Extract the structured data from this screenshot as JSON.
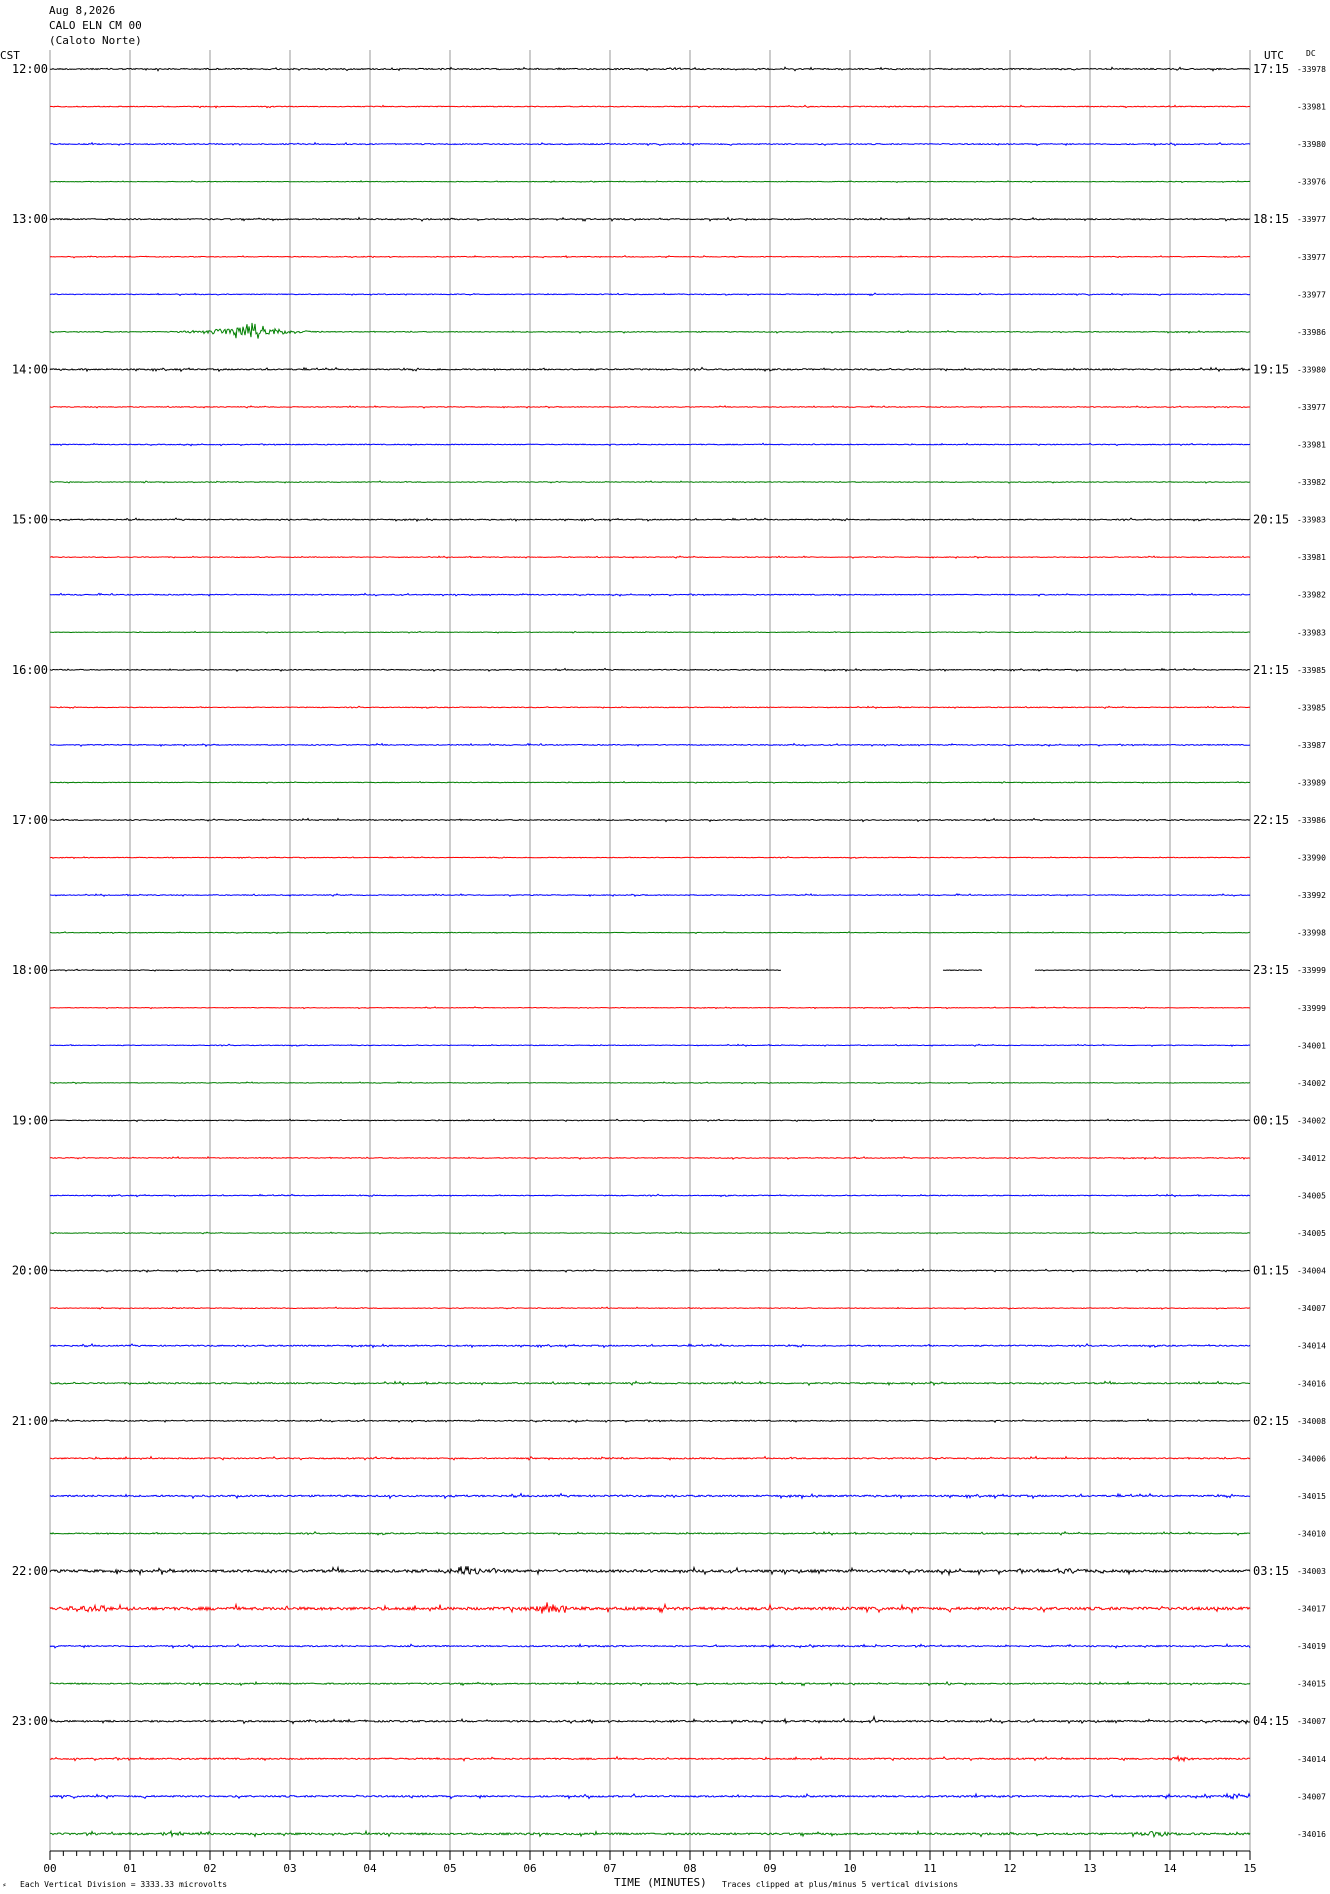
{
  "header": {
    "date": "Aug 8,2026",
    "station": "CALO ELN CM 00",
    "location": "(Caloto Norte)"
  },
  "left_axis_label": "CST",
  "right_axis_label": "UTC",
  "dc_label": "DC",
  "footer": {
    "mark": "⸗",
    "scale_note": "Each Vertical Division = 3333.33 microvolts",
    "xlabel": "TIME (MINUTES)",
    "clip_note": "Traces clipped at plus/minus 5 vertical divisions"
  },
  "colors": {
    "trace_cycle": [
      "#000000",
      "#ff0000",
      "#0000ff",
      "#007f00"
    ],
    "grid": "#999999"
  },
  "chart_data": {
    "type": "line",
    "title": "",
    "xlabel": "TIME (MINUTES)",
    "xlim": [
      0,
      15
    ],
    "x_ticks": [
      "00",
      "01",
      "02",
      "03",
      "04",
      "05",
      "06",
      "07",
      "08",
      "09",
      "10",
      "11",
      "12",
      "13",
      "14",
      "15"
    ],
    "rows_per_hour": 4,
    "hour_labels_cst": [
      "12:00",
      "13:00",
      "14:00",
      "15:00",
      "16:00",
      "17:00",
      "18:00",
      "19:00",
      "20:00",
      "21:00",
      "22:00",
      "23:00"
    ],
    "hour_labels_utc": [
      "17:15",
      "18:15",
      "19:15",
      "20:15",
      "21:15",
      "22:15",
      "23:15",
      "00:15",
      "01:15",
      "02:15",
      "03:15",
      "04:15"
    ],
    "dc_offsets": [
      "-33978",
      "-33981",
      "-33980",
      "-33976",
      "-33977",
      "-33977",
      "-33977",
      "-33986",
      "-33980",
      "-33977",
      "-33981",
      "-33982",
      "-33983",
      "-33981",
      "-33982",
      "-33983",
      "-33985",
      "-33985",
      "-33987",
      "-33989",
      "-33986",
      "-33990",
      "-33992",
      "-33998",
      "-33999",
      "-33999",
      "-34001",
      "-34002",
      "-34002",
      "-34012",
      "-34005",
      "-34005",
      "-34004",
      "-34007",
      "-34014",
      "-34016",
      "-34008",
      "-34006",
      "-34015",
      "-34010",
      "-34003",
      "-34017",
      "-34019",
      "-34015",
      "-34007",
      "-34014",
      "-34007",
      "-34016"
    ],
    "noise_level": [
      1.2,
      0.8,
      1,
      0.6,
      1.2,
      0.7,
      0.8,
      0.8,
      1.3,
      0.7,
      0.8,
      0.7,
      1,
      0.7,
      0.9,
      0.6,
      0.9,
      0.7,
      0.9,
      0.6,
      1,
      0.6,
      0.8,
      0.6,
      0.7,
      0.6,
      0.7,
      0.6,
      0.8,
      0.8,
      0.8,
      0.6,
      1,
      0.7,
      1.2,
      1.3,
      1,
      1.2,
      1.6,
      1.1,
      2.5,
      2.8,
      1.3,
      1.3,
      1.6,
      1.4,
      1.6,
      1.8
    ],
    "events": [
      {
        "row": 7,
        "minute": 2.5,
        "amplitude": 10,
        "duration_min": 0.9
      },
      {
        "row": 41,
        "minute": 0.5,
        "amplitude": 5,
        "duration_min": 0.6
      },
      {
        "row": 41,
        "minute": 6.3,
        "amplitude": 5,
        "duration_min": 0.5
      },
      {
        "row": 40,
        "minute": 5.2,
        "amplitude": 4,
        "duration_min": 0.7
      },
      {
        "row": 40,
        "minute": 12.7,
        "amplitude": 3,
        "duration_min": 0.5
      },
      {
        "row": 44,
        "minute": 10.3,
        "amplitude": 4,
        "duration_min": 0.1
      },
      {
        "row": 45,
        "minute": 14.1,
        "amplitude": 3,
        "duration_min": 0.3
      },
      {
        "row": 47,
        "minute": 1.5,
        "amplitude": 3,
        "duration_min": 0.4
      },
      {
        "row": 47,
        "minute": 13.8,
        "amplitude": 3,
        "duration_min": 0.5
      },
      {
        "row": 46,
        "minute": 14.8,
        "amplitude": 3,
        "duration_min": 0.4
      }
    ],
    "gaps": [
      {
        "row": 24,
        "from_minute": 9.15,
        "to_minute": 11.15
      },
      {
        "row": 24,
        "from_minute": 11.65,
        "to_minute": 12.3
      }
    ]
  }
}
